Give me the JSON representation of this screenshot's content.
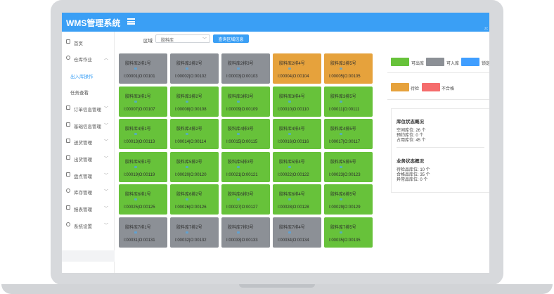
{
  "app": {
    "title": "WMS管理系统",
    "corner_text": "zc"
  },
  "sidebar": {
    "items": [
      {
        "label": "首页",
        "icon": "home-icon"
      },
      {
        "label": "仓库作业",
        "icon": "warehouse-icon"
      },
      {
        "label": "出入库操作",
        "sub": true,
        "active": true
      },
      {
        "label": "任务查看",
        "sub": true
      },
      {
        "label": "订单信息管理",
        "icon": "order-icon"
      },
      {
        "label": "基础信息管理",
        "icon": "grid-icon"
      },
      {
        "label": "送货管理",
        "icon": "delivery-icon"
      },
      {
        "label": "出货管理",
        "icon": "shipping-icon"
      },
      {
        "label": "盘点管理",
        "icon": "inventory-icon"
      },
      {
        "label": "库存管理",
        "icon": "stock-icon"
      },
      {
        "label": "报表管理",
        "icon": "report-icon"
      },
      {
        "label": "系统设置",
        "icon": "settings-icon"
      }
    ]
  },
  "filter": {
    "label": "区域",
    "selected": "胶料库",
    "button": "查询区域信息"
  },
  "grid": {
    "rows": [
      [
        {
          "name": "胶料库2排1号",
          "code": "I:00001|O:00101",
          "status": "gray"
        },
        {
          "name": "胶料库2排2号",
          "code": "I:00002|O:00102",
          "status": "gray"
        },
        {
          "name": "胶料库2排3号",
          "code": "I:00003|O:00103",
          "status": "gray"
        },
        {
          "name": "胶料库2排4号",
          "code": "I:00004|O:00104",
          "status": "orange"
        },
        {
          "name": "胶料库2排5号",
          "code": "I:00005|O:00105",
          "status": "orange"
        }
      ],
      [
        {
          "name": "胶料库3排1号",
          "code": "I:00007|O:00107",
          "status": "green"
        },
        {
          "name": "胶料库3排2号",
          "code": "I:00008|O:00108",
          "status": "green"
        },
        {
          "name": "胶料库3排3号",
          "code": "I:00009|O:00109",
          "status": "green"
        },
        {
          "name": "胶料库3排4号",
          "code": "I:00010|O:00110",
          "status": "green"
        },
        {
          "name": "胶料库3排5号",
          "code": "I:00011|O:00111",
          "status": "green"
        }
      ],
      [
        {
          "name": "胶料库4排1号",
          "code": "I:00013|O:00113",
          "status": "green"
        },
        {
          "name": "胶料库4排2号",
          "code": "I:00014|O:00114",
          "status": "green"
        },
        {
          "name": "胶料库4排3号",
          "code": "I:00015|O:00115",
          "status": "green"
        },
        {
          "name": "胶料库4排4号",
          "code": "I:00016|O:00116",
          "status": "green"
        },
        {
          "name": "胶料库4排5号",
          "code": "I:00017|O:00117",
          "status": "green"
        }
      ],
      [
        {
          "name": "胶料库5排1号",
          "code": "I:00019|O:00119",
          "status": "green"
        },
        {
          "name": "胶料库5排2号",
          "code": "I:00020|O:00120",
          "status": "green"
        },
        {
          "name": "胶料库5排3号",
          "code": "I:00021|O:00121",
          "status": "green"
        },
        {
          "name": "胶料库5排4号",
          "code": "I:00022|O:00122",
          "status": "green"
        },
        {
          "name": "胶料库5排5号",
          "code": "I:00023|O:00123",
          "status": "green"
        }
      ],
      [
        {
          "name": "胶料库6排1号",
          "code": "I:00025|O:00125",
          "status": "green"
        },
        {
          "name": "胶料库6排2号",
          "code": "I:00026|O:00126",
          "status": "green"
        },
        {
          "name": "胶料库6排3号",
          "code": "I:00027|O:00127",
          "status": "green"
        },
        {
          "name": "胶料库6排4号",
          "code": "I:00028|O:00128",
          "status": "green"
        },
        {
          "name": "胶料库6排5号",
          "code": "I:00029|O:00129",
          "status": "green"
        }
      ],
      [
        {
          "name": "胶料库7排1号",
          "code": "I:00031|O:00131",
          "status": "gray"
        },
        {
          "name": "胶料库7排2号",
          "code": "I:00032|O:00132",
          "status": "gray"
        },
        {
          "name": "胶料库7排3号",
          "code": "I:00033|O:00133",
          "status": "gray"
        },
        {
          "name": "胶料库7排4号",
          "code": "I:00034|O:00134",
          "status": "gray"
        },
        {
          "name": "胶料库7排5号",
          "code": "I:00035|O:00135",
          "status": "green"
        }
      ]
    ]
  },
  "legend": {
    "can_out": {
      "label": "可出库",
      "color": "#67c23a"
    },
    "can_in": {
      "label": "可入库",
      "color": "#8c9096"
    },
    "locked": {
      "label": "锁定",
      "color": "#409eff"
    },
    "pending": {
      "label": "待检",
      "color": "#e6a23c"
    },
    "rejected": {
      "label": "不合格",
      "color": "#f56c6c"
    }
  },
  "location_status": {
    "title": "库位状态概况",
    "lines": [
      "空闲库位: 26 个",
      "预约库位: 0 个",
      "占用库位: 45 个"
    ]
  },
  "business_status": {
    "title": "业务状态概况",
    "lines": [
      "待检品库位: 10 个",
      "合格品库位: 35 个",
      "异常品库位: 0 个"
    ]
  }
}
